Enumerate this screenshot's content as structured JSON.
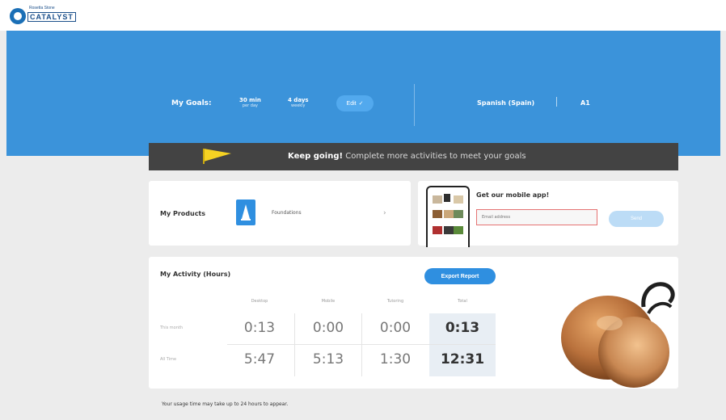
{
  "brand": {
    "top": "Rosetta Stone",
    "name": "CATALYST"
  },
  "goals": {
    "label": "My Goals:",
    "minutes": {
      "value": "30 min",
      "sub": "per day"
    },
    "days": {
      "value": "4 days",
      "sub": "weekly"
    },
    "edit_label": "Edit"
  },
  "language": {
    "name": "Spanish (Spain)",
    "level": "A1"
  },
  "banner": {
    "bold": "Keep going!",
    "rest": "Complete more activities to meet your goals"
  },
  "products": {
    "title": "My Products",
    "item": "Foundations"
  },
  "mobile": {
    "title": "Get our mobile app!",
    "email_placeholder": "Email address",
    "send_label": "Send"
  },
  "activity": {
    "title": "My Activity (Hours)",
    "export_label": "Export Report",
    "columns": [
      "Desktop",
      "Mobile",
      "Tutoring",
      "Total"
    ],
    "rows": [
      {
        "label": "This month",
        "values": [
          "0:13",
          "0:00",
          "0:00",
          "0:13"
        ]
      },
      {
        "label": "All Time",
        "values": [
          "5:47",
          "5:13",
          "1:30",
          "12:31"
        ]
      }
    ]
  },
  "footnote": "Your usage time may take up to 24 hours to appear.",
  "colors": {
    "hero": "#3b93da",
    "banner": "#434343",
    "accent": "#2f8fe0",
    "background": "#ececec"
  }
}
